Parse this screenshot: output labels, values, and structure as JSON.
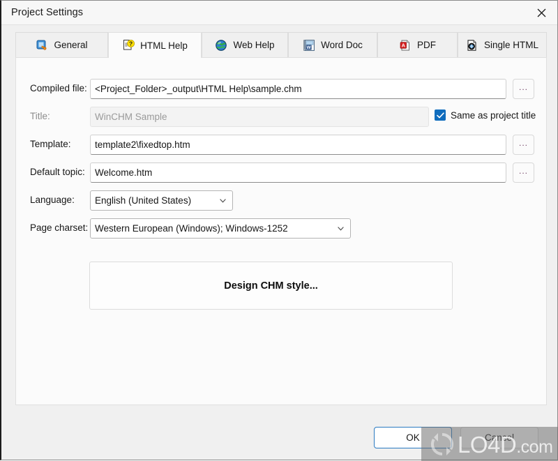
{
  "window": {
    "title": "Project Settings",
    "close_icon": "close-icon"
  },
  "tabs": [
    {
      "label": "General",
      "icon": "general-icon",
      "active": false
    },
    {
      "label": "HTML Help",
      "icon": "html-help-icon",
      "active": true
    },
    {
      "label": "Web Help",
      "icon": "web-help-icon",
      "active": false
    },
    {
      "label": "Word Doc",
      "icon": "word-doc-icon",
      "active": false
    },
    {
      "label": "PDF",
      "icon": "pdf-icon",
      "active": false
    },
    {
      "label": "Single HTML",
      "icon": "single-html-icon",
      "active": false
    }
  ],
  "form": {
    "compiled_file": {
      "label": "Compiled file:",
      "value": "<Project_Folder>_output\\HTML Help\\sample.chm",
      "browse_label": "..."
    },
    "title": {
      "label": "Title:",
      "value": "WinCHM Sample",
      "disabled": true
    },
    "same_as_project_title": {
      "label": "Same as project title",
      "checked": true,
      "check_glyph": "check-icon"
    },
    "template": {
      "label": "Template:",
      "value": "template2\\fixedtop.htm",
      "browse_label": "..."
    },
    "default_topic": {
      "label": "Default topic:",
      "value": "Welcome.htm",
      "browse_label": "..."
    },
    "language": {
      "label": "Language:",
      "value": "English (United States)"
    },
    "page_charset": {
      "label": "Page charset:",
      "value": "Western European (Windows); Windows-1252"
    },
    "design_button": {
      "label": "Design CHM style..."
    }
  },
  "footer": {
    "ok_label": "OK",
    "cancel_label": "Cancel"
  },
  "watermark": {
    "text": "LO4D",
    "suffix": ".com",
    "logo": "refresh-circle-icon"
  },
  "colors": {
    "accent": "#0f6cbd",
    "ok_border": "#2a7ac1",
    "panel_bg": "#fbfbfb",
    "window_bg": "#f0f0f0",
    "text": "#161616",
    "disabled_text": "#9a9a9a"
  }
}
